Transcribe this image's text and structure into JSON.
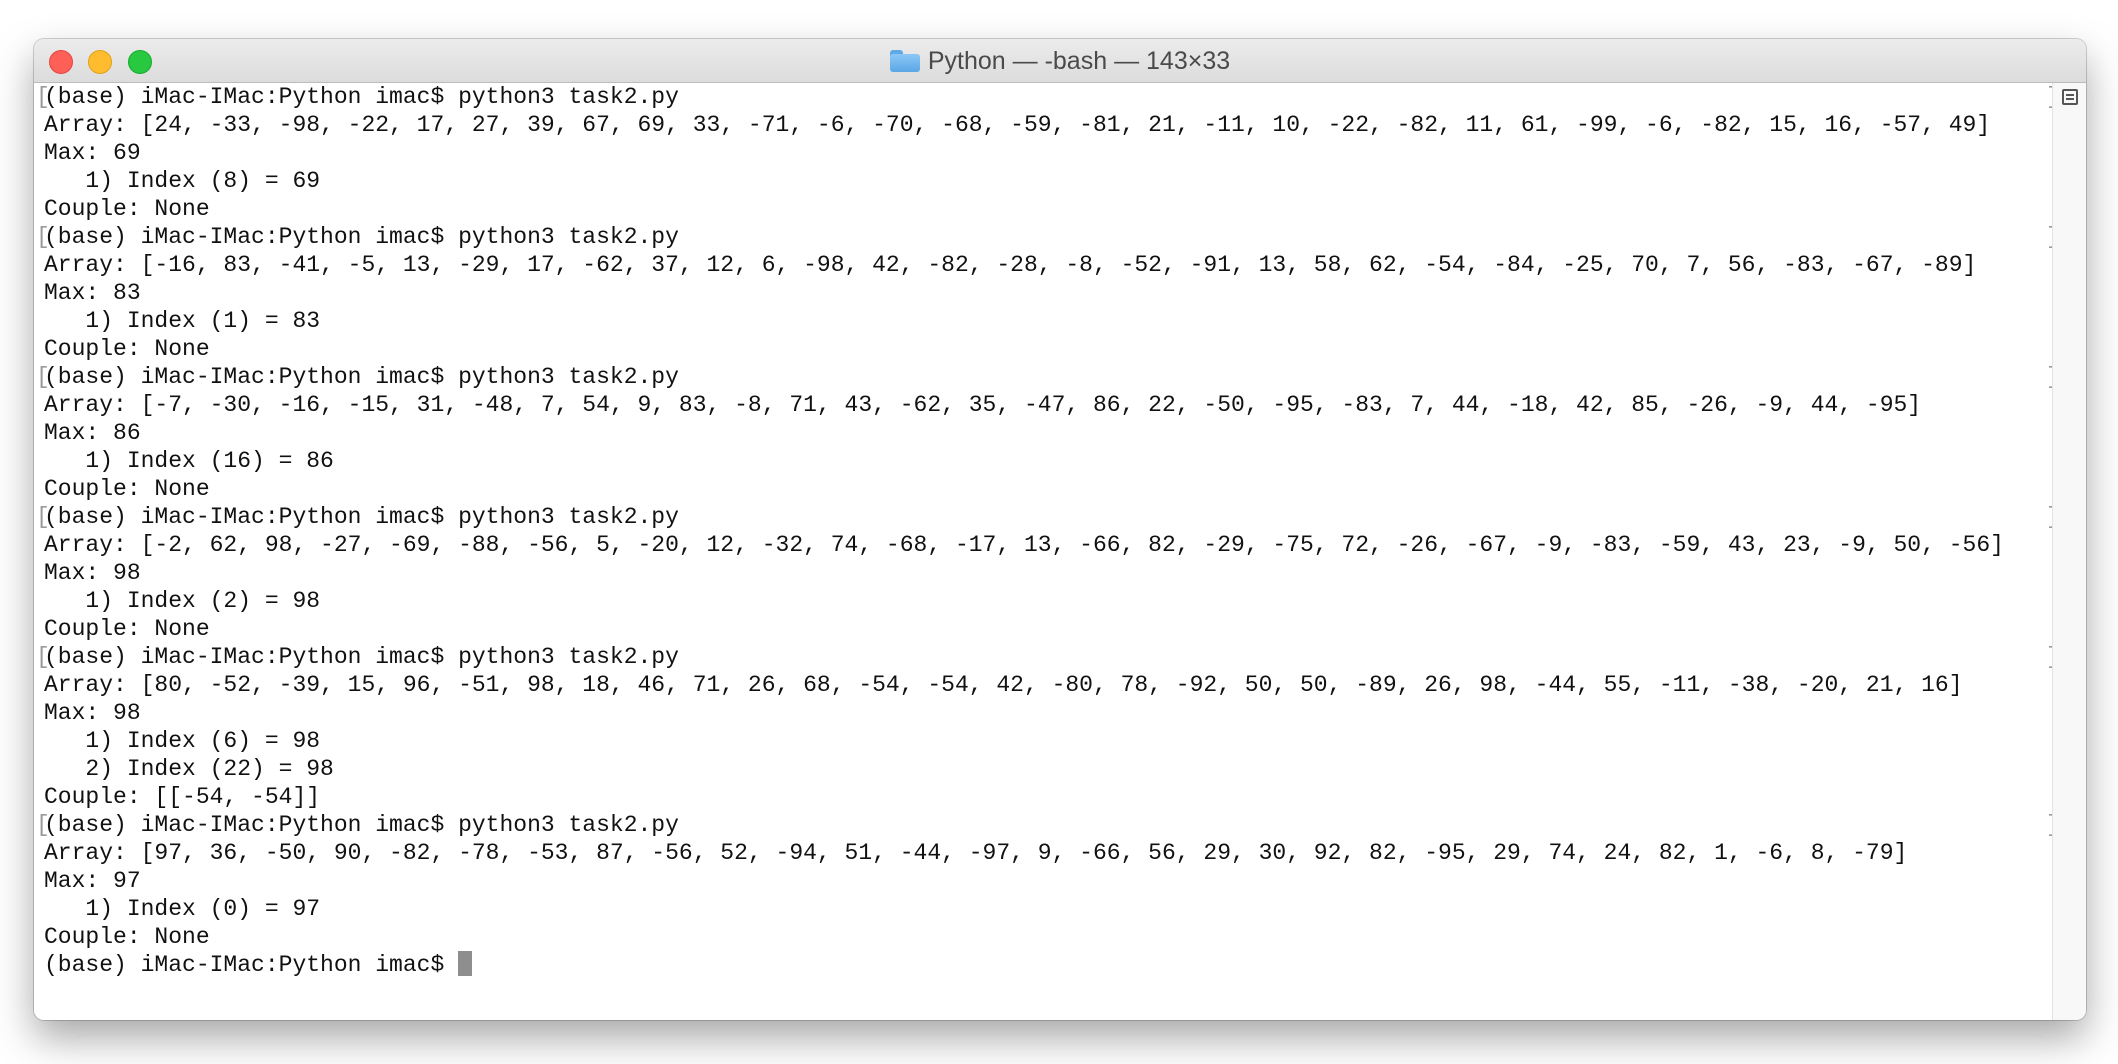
{
  "window": {
    "title": "Python — -bash — 143×33"
  },
  "icons": {
    "folder": "folder-icon",
    "close": "close-icon",
    "minimize": "minimize-icon",
    "zoom": "zoom-icon",
    "marks": "marks-list-icon"
  },
  "colors": {
    "close": "#fe5f57",
    "minimize": "#febc2e",
    "zoom": "#28c840",
    "cursor": "#8e8e8e"
  },
  "terminal": {
    "lines": [
      {
        "text": "(base) iMac-IMac:Python imac$ python3 task2.py",
        "mark": true
      },
      {
        "text": "Array: [24, -33, -98, -22, 17, 27, 39, 67, 69, 33, -71, -6, -70, -68, -59, -81, 21, -11, 10, -22, -82, 11, 61, -99, -6, -82, 15, 16, -57, 49]",
        "mark": false
      },
      {
        "text": "Max: 69",
        "mark": false
      },
      {
        "text": "   1) Index (8) = 69",
        "mark": false
      },
      {
        "text": "Couple: None",
        "mark": false
      },
      {
        "text": "(base) iMac-IMac:Python imac$ python3 task2.py",
        "mark": true
      },
      {
        "text": "Array: [-16, 83, -41, -5, 13, -29, 17, -62, 37, 12, 6, -98, 42, -82, -28, -8, -52, -91, 13, 58, 62, -54, -84, -25, 70, 7, 56, -83, -67, -89]",
        "mark": false
      },
      {
        "text": "Max: 83",
        "mark": false
      },
      {
        "text": "   1) Index (1) = 83",
        "mark": false
      },
      {
        "text": "Couple: None",
        "mark": false
      },
      {
        "text": "(base) iMac-IMac:Python imac$ python3 task2.py",
        "mark": true
      },
      {
        "text": "Array: [-7, -30, -16, -15, 31, -48, 7, 54, 9, 83, -8, 71, 43, -62, 35, -47, 86, 22, -50, -95, -83, 7, 44, -18, 42, 85, -26, -9, 44, -95]",
        "mark": false
      },
      {
        "text": "Max: 86",
        "mark": false
      },
      {
        "text": "   1) Index (16) = 86",
        "mark": false
      },
      {
        "text": "Couple: None",
        "mark": false
      },
      {
        "text": "(base) iMac-IMac:Python imac$ python3 task2.py",
        "mark": true
      },
      {
        "text": "Array: [-2, 62, 98, -27, -69, -88, -56, 5, -20, 12, -32, 74, -68, -17, 13, -66, 82, -29, -75, 72, -26, -67, -9, -83, -59, 43, 23, -9, 50, -56]",
        "mark": false
      },
      {
        "text": "Max: 98",
        "mark": false
      },
      {
        "text": "   1) Index (2) = 98",
        "mark": false
      },
      {
        "text": "Couple: None",
        "mark": false
      },
      {
        "text": "(base) iMac-IMac:Python imac$ python3 task2.py",
        "mark": true
      },
      {
        "text": "Array: [80, -52, -39, 15, 96, -51, 98, 18, 46, 71, 26, 68, -54, -54, 42, -80, 78, -92, 50, 50, -89, 26, 98, -44, 55, -11, -38, -20, 21, 16]",
        "mark": false
      },
      {
        "text": "Max: 98",
        "mark": false
      },
      {
        "text": "   1) Index (6) = 98",
        "mark": false
      },
      {
        "text": "   2) Index (22) = 98",
        "mark": false
      },
      {
        "text": "Couple: [[-54, -54]]",
        "mark": false
      },
      {
        "text": "(base) iMac-IMac:Python imac$ python3 task2.py",
        "mark": true
      },
      {
        "text": "Array: [97, 36, -50, 90, -82, -78, -53, 87, -56, 52, -94, 51, -44, -97, 9, -66, 56, 29, 30, 92, 82, -95, 29, 74, 24, 82, 1, -6, 8, -79]",
        "mark": false
      },
      {
        "text": "Max: 97",
        "mark": false
      },
      {
        "text": "   1) Index (0) = 97",
        "mark": false
      },
      {
        "text": "Couple: None",
        "mark": false
      }
    ],
    "prompt": "(base) iMac-IMac:Python imac$ ",
    "mark_left": "[",
    "mark_right": "]"
  }
}
